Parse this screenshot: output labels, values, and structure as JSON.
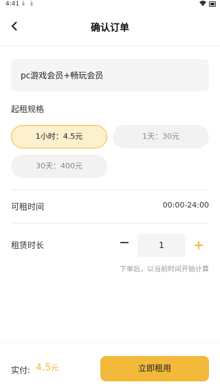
{
  "status_bar": {
    "time": "4:41",
    "icons": [
      "download-icon",
      "download-icon",
      "wifi-icon",
      "battery-icon"
    ]
  },
  "header": {
    "back_icon": "chevron-left-icon",
    "title": "确认订单"
  },
  "product": {
    "name": "pc游戏会员+畅玩会员"
  },
  "specs": {
    "label": "起租规格",
    "options": [
      {
        "label": "1小时：4.5元",
        "selected": true
      },
      {
        "label": "1天：30元",
        "selected": false
      },
      {
        "label": "30天：400元",
        "selected": false
      }
    ]
  },
  "availability": {
    "label": "可租时间",
    "value": "00:00-24:00"
  },
  "duration": {
    "label": "租赁时长",
    "value": "1",
    "hint": "下单后，以当前时间开始计算"
  },
  "footer": {
    "pay_label": "实付:",
    "pay_amount": "4.5",
    "pay_unit": "元",
    "rent_button_label": "立即租用"
  },
  "colors": {
    "accent": "#f2b93a",
    "selected_bg": "#fdf0cc",
    "chip_bg": "#f2f2f2"
  }
}
